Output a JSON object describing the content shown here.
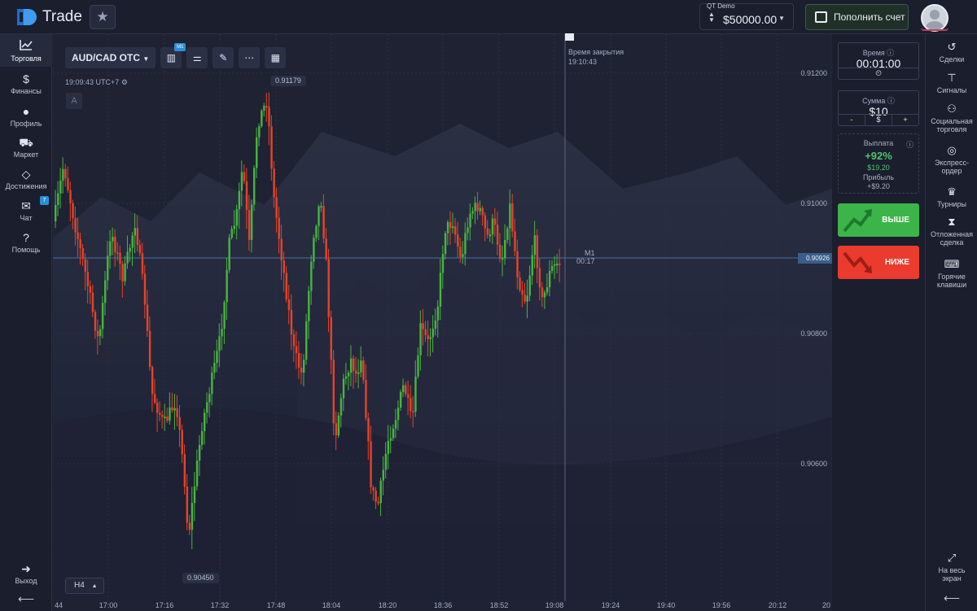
{
  "header": {
    "brand": "Trade",
    "account_type": "QT Demo",
    "balance": "$50000.00",
    "deposit_label": "Пополнить счет"
  },
  "left_nav": [
    {
      "label": "Торговля",
      "icon": "chart-icon"
    },
    {
      "label": "Финансы",
      "icon": "dollar-icon"
    },
    {
      "label": "Профиль",
      "icon": "user-icon"
    },
    {
      "label": "Маркет",
      "icon": "cart-icon"
    },
    {
      "label": "Достижения",
      "icon": "diamond-icon"
    },
    {
      "label": "Чат",
      "icon": "chat-icon",
      "badge": "7"
    },
    {
      "label": "Помощь",
      "icon": "help-icon"
    }
  ],
  "left_nav_bottom": {
    "exit_label": "Выход"
  },
  "right_nav": [
    {
      "label": "Сделки",
      "icon": "history-icon"
    },
    {
      "label": "Сигналы",
      "icon": "signal-icon"
    },
    {
      "label": "Социальная торговля",
      "icon": "group-icon"
    },
    {
      "label": "Экспресс-ордер",
      "icon": "express-icon"
    },
    {
      "label": "Турниры",
      "icon": "trophy-icon"
    },
    {
      "label": "Отложенная сделка",
      "icon": "hourglass-icon"
    },
    {
      "label": "Горячие клавиши",
      "icon": "keyboard-icon"
    }
  ],
  "right_nav_bottom": {
    "fullscreen_label": "На весь экран"
  },
  "chart_toolbar": {
    "pair": "AUD/CAD OTC",
    "timeframe_badge": "M1",
    "clock": "19:09:43 UTC+7",
    "a_button": "A",
    "timeframe": "H4"
  },
  "chart_labels": {
    "high_tag": "0.91179",
    "low_tag": "0.90450",
    "close_time_label": "Время закрытия",
    "close_time": "19:10:43",
    "m1_label": "M1",
    "m1_countdown": "00:17",
    "current_price": "0.90926"
  },
  "panel": {
    "time_title": "Время",
    "time_value": "00:01:00",
    "amount_title": "Сумма",
    "amount_value": "$10",
    "amount_minus": "-",
    "amount_currency": "$",
    "amount_plus": "+",
    "payout_title": "Выплата",
    "payout_pct": "+92%",
    "payout_amount": "$19.20",
    "profit_label": "Прибыль",
    "profit_value": "+$9.20",
    "up_label": "ВЫШЕ",
    "down_label": "НИЖЕ"
  },
  "colors": {
    "up": "#3cb44a",
    "down": "#ea3b2e",
    "candle_up": "#48b540",
    "candle_down": "#e7432a"
  },
  "chart_data": {
    "type": "candlestick",
    "y_ticks": [
      "0.91200",
      "0.91000",
      "0.90800",
      "0.90600"
    ],
    "x_ticks": [
      "44",
      "17:00",
      "17:16",
      "17:32",
      "17:48",
      "18:04",
      "18:20",
      "18:36",
      "18:52",
      "19:08",
      "19:24",
      "19:40",
      "19:56",
      "20:12",
      "20"
    ],
    "ylim": [
      0.9045,
      0.9118
    ]
  }
}
